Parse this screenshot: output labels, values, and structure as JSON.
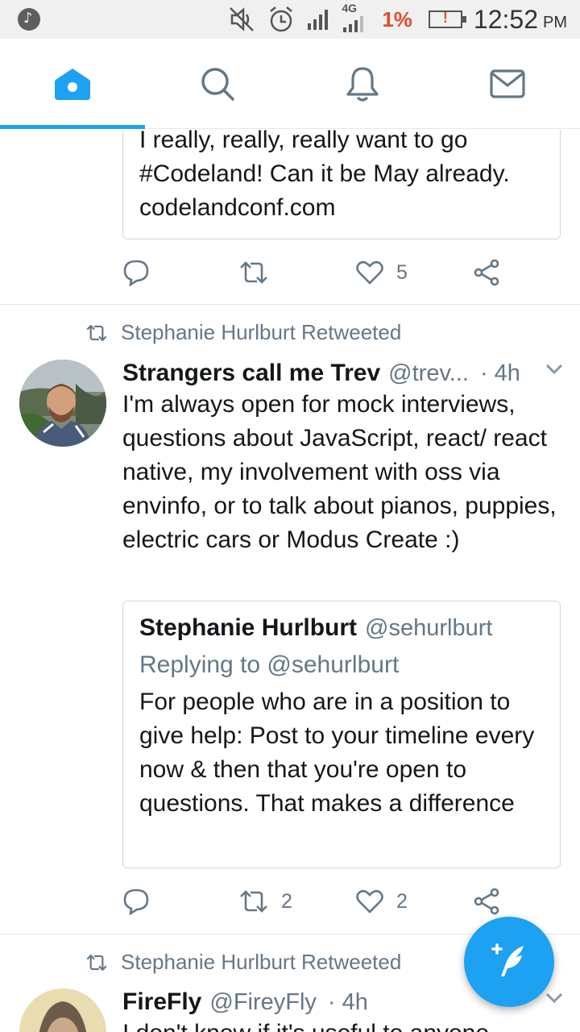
{
  "status_bar": {
    "battery_percent": "1%",
    "battery_warning": "!",
    "network": "4G",
    "time": "12:52",
    "ampm": "PM"
  },
  "tabs": [
    {
      "name": "home",
      "icon": "home-icon",
      "active": true
    },
    {
      "name": "search",
      "icon": "search-icon",
      "active": false
    },
    {
      "name": "notifications",
      "icon": "bell-icon",
      "active": false
    },
    {
      "name": "messages",
      "icon": "mail-icon",
      "active": false
    }
  ],
  "colors": {
    "accent": "#1da1f2",
    "secondary_text": "#657786",
    "battery_low": "#e34b2b"
  },
  "top_quote": {
    "text": "I really, really, really want to go #Codeland! Can it be May already. codelandconf.com",
    "actions": {
      "reply": "",
      "retweet": "",
      "like": "5"
    }
  },
  "tweet1": {
    "retweeted_by": "Stephanie Hurlburt Retweeted",
    "name": "Strangers call me Trev",
    "handle": "@trev...",
    "time": "4h",
    "text": "I'm always open for mock interviews, questions about JavaScript, react/ react native, my involvement with oss via envinfo, or to talk about pianos, puppies, electric cars or Modus Create :)",
    "quote": {
      "name": "Stephanie Hurlburt",
      "handle": "@sehurlburt",
      "replying_to": "Replying to @sehurlburt",
      "text": "For people who are in a position to give help: Post to your timeline every now & then that you're open to questions. That makes a difference"
    },
    "actions": {
      "reply": "",
      "retweet": "2",
      "like": "2"
    }
  },
  "tweet2": {
    "retweeted_by": "Stephanie Hurlburt Retweeted",
    "name": "FireFly",
    "handle": "@FireyFly",
    "time": "4h",
    "text": "I don't know if it's useful to anyone"
  }
}
